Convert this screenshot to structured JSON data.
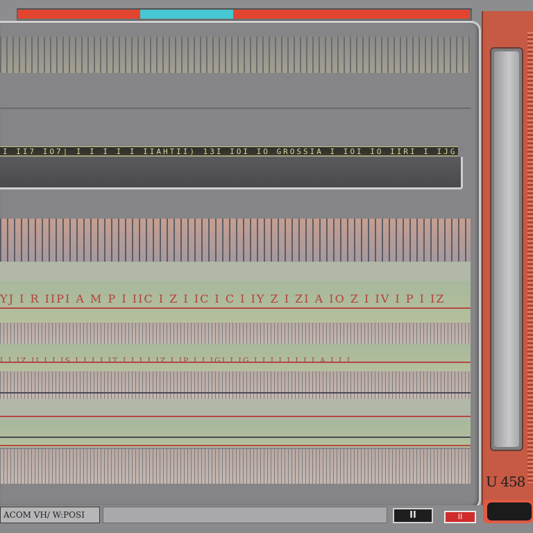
{
  "top_bar": {
    "colors": {
      "primary": "#e2452f",
      "accent": "#46c8d4"
    }
  },
  "main": {
    "label_strip_text": "I II7 IO7| I I I I I IIAHTII) 13I IOI IO GROSSIA I IOI IO IIRI I IJGIII",
    "scrawl_row_1": "YJ I R IIPI    A M P I IIC I Z I IC I C I IY Z I ZI A IO Z I IV I P I IZ",
    "scrawl_row_2": "I I IZ II I I IS I I I  I IT I I I I IZ I IP I I IGI I IG I I I I I I I I A I I I"
  },
  "side_panel": {
    "readout": "U 458"
  },
  "status_bar": {
    "label": "ACOM VH/ W:POSI",
    "pause_label": "II",
    "stop_label": "II"
  }
}
